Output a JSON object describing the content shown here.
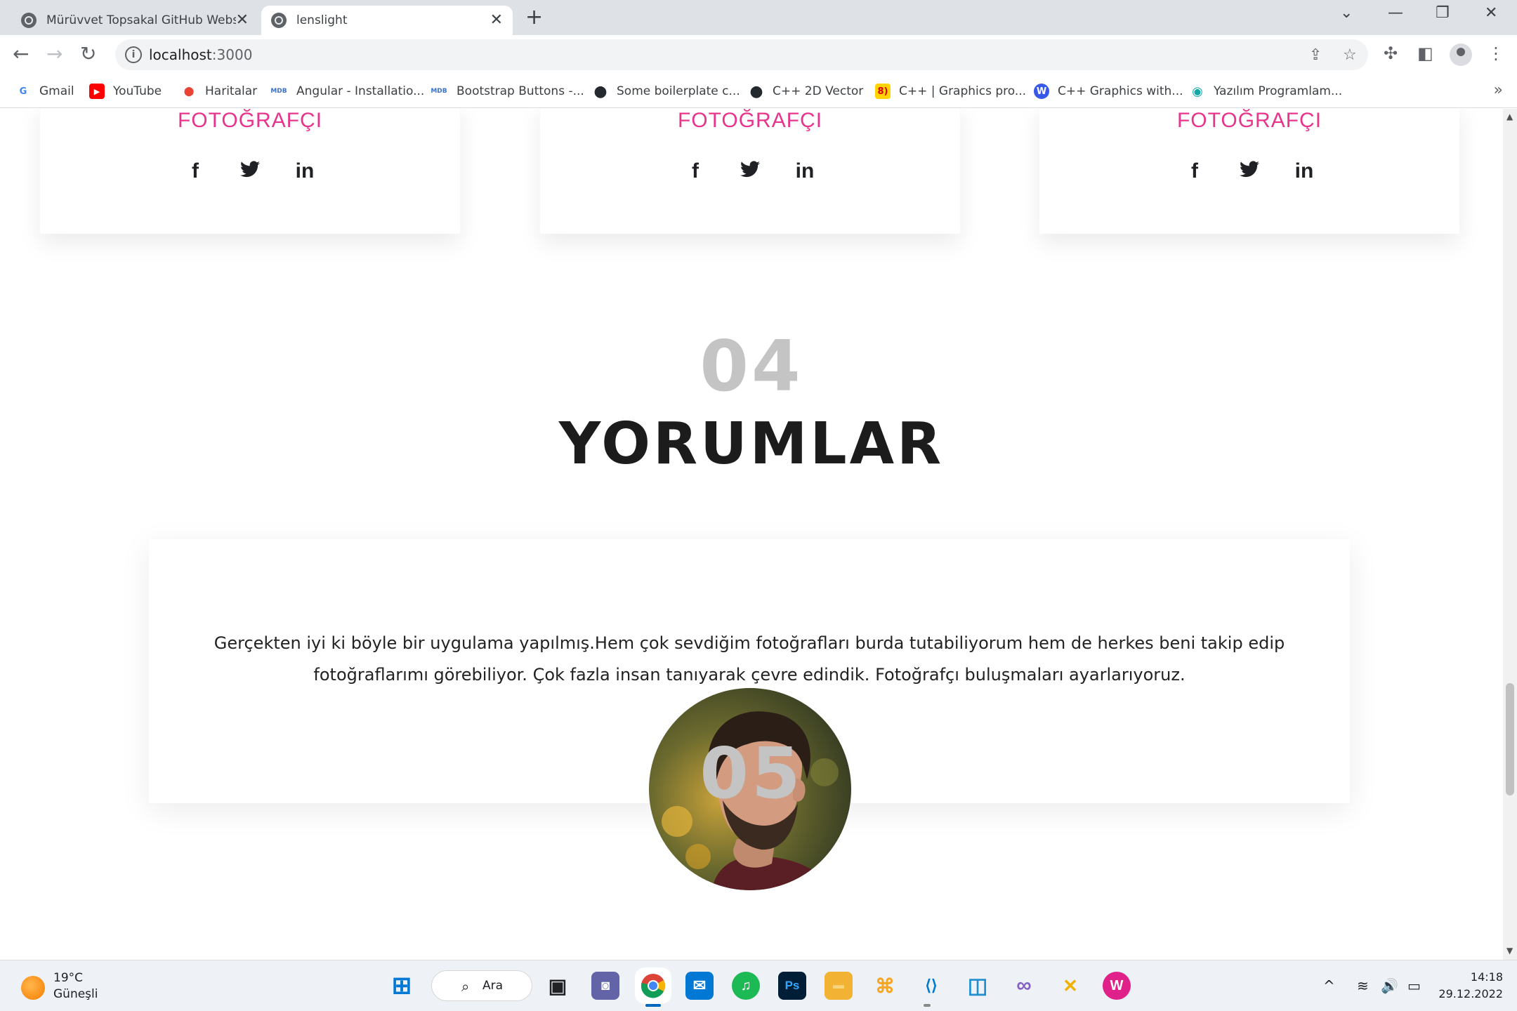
{
  "browser": {
    "tabs": [
      {
        "title": "Mürüvvet Topsakal GitHub Websi",
        "close": "✕"
      },
      {
        "title": "lenslight",
        "close": "✕"
      }
    ],
    "new_tab": "+",
    "window_controls": {
      "tabsearch": "⌄",
      "minimize": "—",
      "restore": "❐",
      "close": "✕"
    },
    "nav": {
      "back": "←",
      "forward": "→",
      "reload": "↻"
    },
    "address": {
      "host": "localhost",
      "port": ":3000"
    },
    "bookmarks": [
      {
        "label": "Gmail",
        "icon": "G",
        "color": "#ea4335"
      },
      {
        "label": "YouTube",
        "icon": "▶",
        "color": "#ff0000"
      },
      {
        "label": "Haritalar",
        "icon": "⬤",
        "color": "#34a853"
      },
      {
        "label": "Angular - Installatio...",
        "icon": "MDB",
        "color": "#3b71ca"
      },
      {
        "label": "Bootstrap Buttons -...",
        "icon": "MDB",
        "color": "#3b71ca"
      },
      {
        "label": "Some boilerplate c...",
        "icon": "●",
        "color": "#24292f"
      },
      {
        "label": "C++ 2D Vector",
        "icon": "●",
        "color": "#24292f"
      },
      {
        "label": "C++ | Graphics pro...",
        "icon": "8)",
        "color": "#ffd400"
      },
      {
        "label": "C++ Graphics with...",
        "icon": "W",
        "color": "#3858e9"
      },
      {
        "label": "Yazılım Programlam...",
        "icon": "◉",
        "color": "#12a8a8"
      }
    ],
    "bookmarks_more": "»"
  },
  "page": {
    "team": [
      {
        "role": "FOTOĞRAFÇI",
        "social": {
          "facebook": "f",
          "twitter": "🐦",
          "linkedin": "in"
        }
      },
      {
        "role": "FOTOĞRAFÇI",
        "social": {
          "facebook": "f",
          "twitter": "🐦",
          "linkedin": "in"
        }
      },
      {
        "role": "FOTOĞRAFÇI",
        "social": {
          "facebook": "f",
          "twitter": "🐦",
          "linkedin": "in"
        }
      }
    ],
    "section_number": "04",
    "section_title": "YORUMLAR",
    "review": {
      "line1": "Gerçekten iyi ki böyle bir uygulama yapılmış.Hem çok sevdiğim fotoğrafları burda tutabiliyorum hem de herkes beni takip edip",
      "line2": "fotoğraflarımı görebiliyor. Çok fazla insan tanıyarak çevre edindik. Fotoğrafçı buluşmaları ayarlarıyoruz."
    },
    "next_section_number": "05",
    "accent_color": "#e8348c"
  },
  "taskbar": {
    "weather": {
      "temp": "19°C",
      "desc": "Güneşli"
    },
    "search": "Ara",
    "apps": [
      {
        "name": "start",
        "glyph": "⊞",
        "color": "#0078d4"
      },
      {
        "name": "task-view",
        "glyph": "▣",
        "color": "#202124"
      },
      {
        "name": "teams",
        "glyph": "◙",
        "color": "#6264a7"
      },
      {
        "name": "chrome",
        "glyph": "◉",
        "color": "#34a853"
      },
      {
        "name": "mail",
        "glyph": "✉",
        "color": "#0078d4"
      },
      {
        "name": "spotify",
        "glyph": "♫",
        "color": "#1db954"
      },
      {
        "name": "photoshop",
        "glyph": "Ps",
        "color": "#001e36"
      },
      {
        "name": "file-explorer",
        "glyph": "▬",
        "color": "#f2b233"
      },
      {
        "name": "workflow",
        "glyph": "⌘",
        "color": "#f5a623"
      },
      {
        "name": "vscode",
        "glyph": "⟨⟩",
        "color": "#007acc"
      },
      {
        "name": "virtualbox",
        "glyph": "◫",
        "color": "#1f8fd0"
      },
      {
        "name": "visual-studio",
        "glyph": "∞",
        "color": "#8661c5"
      },
      {
        "name": "dev-tool",
        "glyph": "✕",
        "color": "#f0b100"
      },
      {
        "name": "wamp",
        "glyph": "W",
        "color": "#e0218a"
      }
    ],
    "tray": {
      "chevron": "^",
      "wifi": "≋",
      "volume": "🔊",
      "battery": "▭"
    },
    "clock": {
      "time": "14:18",
      "date": "29.12.2022"
    }
  }
}
